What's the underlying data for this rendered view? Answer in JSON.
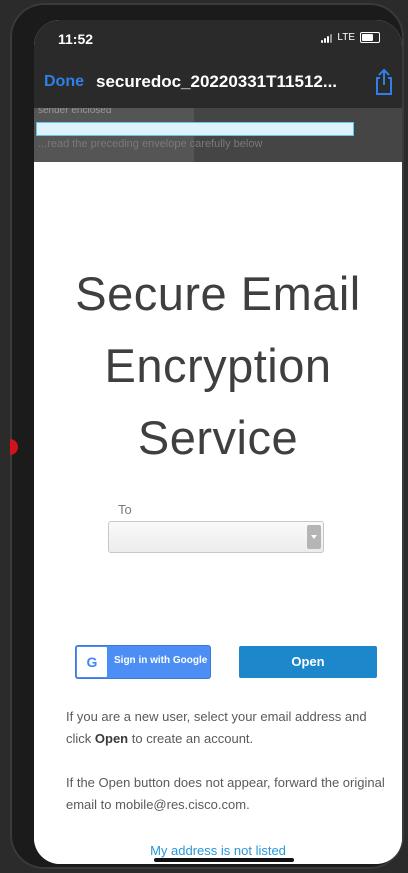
{
  "status": {
    "time": "11:52",
    "network": "LTE"
  },
  "nav": {
    "done_label": "Done",
    "title": "securedoc_20220331T11512..."
  },
  "banner": {
    "ghost_line_1": "sender enclosed",
    "ghost_line_2": "...read the preceding envelope carefully below"
  },
  "main": {
    "heading_line_1": "Secure Email",
    "heading_line_2": "Encryption",
    "heading_line_3": "Service",
    "to_label": "To",
    "to_value": ""
  },
  "buttons": {
    "google_g": "G",
    "google_label": "Sign in with Google",
    "open_label": "Open"
  },
  "info": {
    "p1_a": "If you are a new user, select your email address and click ",
    "p1_b": "Open",
    "p1_c": " to create an account.",
    "p2": "If the Open button does not appear, forward the original email to mobile@res.cisco.com."
  },
  "link": {
    "not_listed": "My address is not listed"
  },
  "colors": {
    "accent_blue": "#1d87cc",
    "google_blue": "#4c8ef4",
    "done_blue": "#2f7fe6",
    "link_blue": "#2a97d8"
  },
  "icons": [
    "signal-icon",
    "battery-icon",
    "share-icon",
    "dropdown-arrow-icon",
    "google-icon"
  ]
}
